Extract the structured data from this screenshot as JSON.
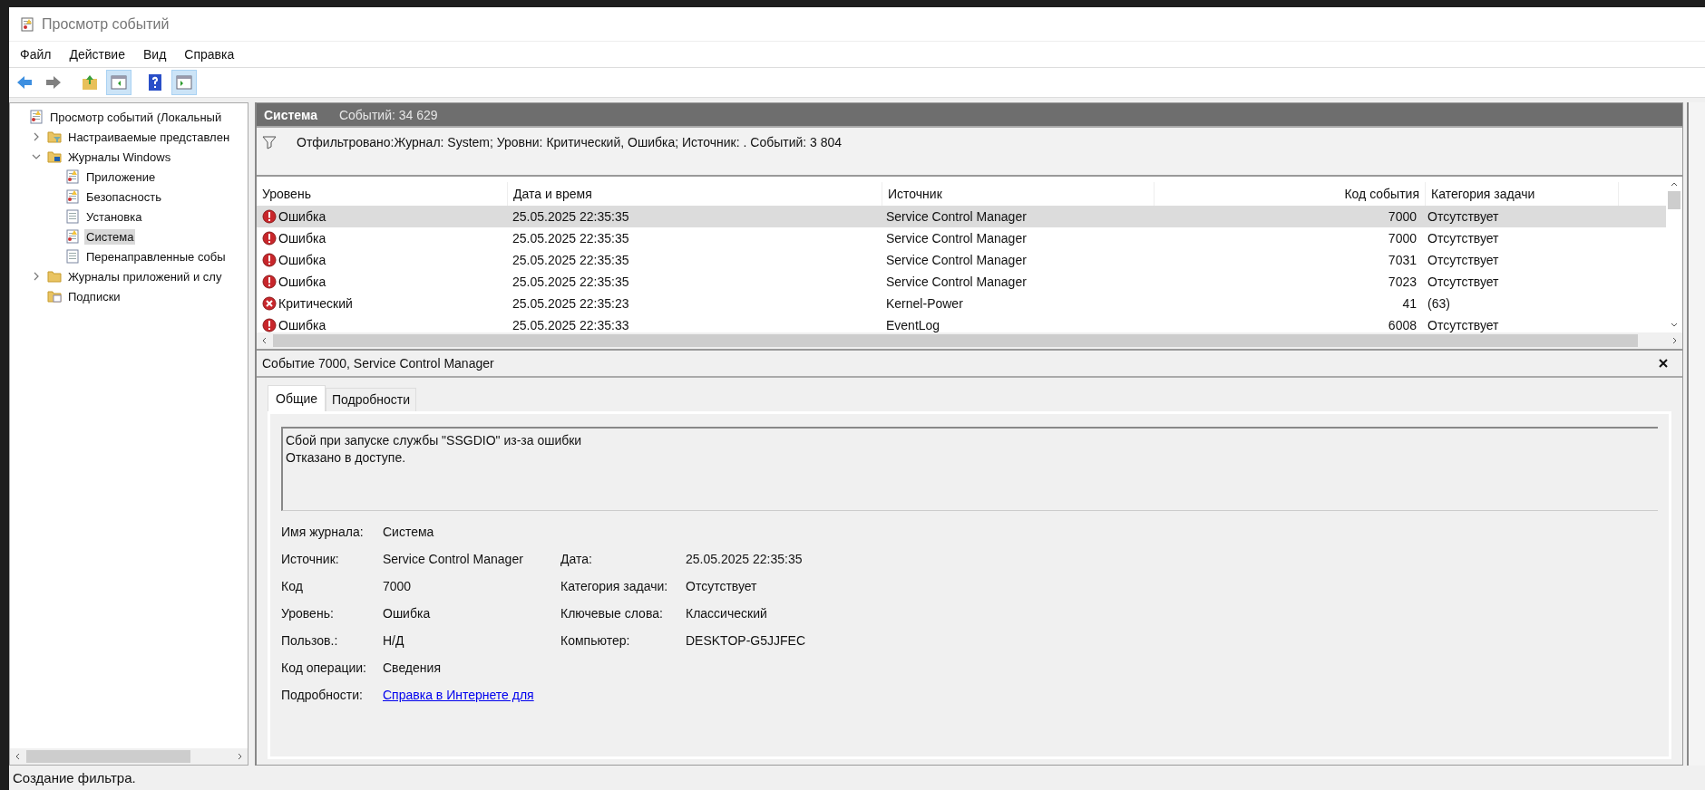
{
  "window": {
    "title": "Просмотр событий"
  },
  "menu": [
    "Файл",
    "Действие",
    "Вид",
    "Справка"
  ],
  "toolbar": [
    {
      "kind": "back",
      "pressed": false
    },
    {
      "kind": "forward",
      "pressed": false
    },
    {
      "kind": "up",
      "pressed": false
    },
    {
      "kind": "console-tree",
      "pressed": true
    },
    {
      "kind": "help",
      "pressed": false
    },
    {
      "kind": "action-pane",
      "pressed": true
    }
  ],
  "tree": [
    {
      "label": "Просмотр событий (Локальный",
      "kind": "log",
      "selected": false,
      "children": [
        {
          "label": "Настраиваемые представлен",
          "kind": "folder-filter",
          "expanded": false,
          "selected": false
        },
        {
          "label": "Журналы Windows",
          "kind": "folder-logs",
          "expanded": true,
          "selected": false,
          "children": [
            {
              "label": "Приложение",
              "kind": "log",
              "selected": false
            },
            {
              "label": "Безопасность",
              "kind": "log",
              "selected": false
            },
            {
              "label": "Установка",
              "kind": "log-plain",
              "selected": false
            },
            {
              "label": "Система",
              "kind": "log",
              "selected": true
            },
            {
              "label": "Перенаправленные собы",
              "kind": "log-plain",
              "selected": false
            }
          ]
        },
        {
          "label": "Журналы приложений и слу",
          "kind": "folder",
          "expanded": false,
          "selected": false
        },
        {
          "label": "Подписки",
          "kind": "folder-subs",
          "selected": false
        }
      ]
    }
  ],
  "header": {
    "title": "Система",
    "count": "Событий: 34 629"
  },
  "filter": "Отфильтровано:Журнал: System; Уровни: Критический, Ошибка; Источник: . Событий: 3 804",
  "table": {
    "columns": [
      "Уровень",
      "Дата и время",
      "Источник",
      "Код события",
      "Категория задачи"
    ],
    "rows": [
      {
        "kind": "error",
        "level": "Ошибка",
        "date": "25.05.2025 22:35:35",
        "source": "Service Control Manager",
        "code": "7000",
        "category": "Отсутствует",
        "selected": true
      },
      {
        "kind": "error",
        "level": "Ошибка",
        "date": "25.05.2025 22:35:35",
        "source": "Service Control Manager",
        "code": "7000",
        "category": "Отсутствует",
        "selected": false
      },
      {
        "kind": "error",
        "level": "Ошибка",
        "date": "25.05.2025 22:35:35",
        "source": "Service Control Manager",
        "code": "7031",
        "category": "Отсутствует",
        "selected": false
      },
      {
        "kind": "error",
        "level": "Ошибка",
        "date": "25.05.2025 22:35:35",
        "source": "Service Control Manager",
        "code": "7023",
        "category": "Отсутствует",
        "selected": false
      },
      {
        "kind": "critical",
        "level": "Критический",
        "date": "25.05.2025 22:35:23",
        "source": "Kernel-Power",
        "code": "41",
        "category": "(63)",
        "selected": false
      },
      {
        "kind": "error",
        "level": "Ошибка",
        "date": "25.05.2025 22:35:33",
        "source": "EventLog",
        "code": "6008",
        "category": "Отсутствует",
        "selected": false
      }
    ]
  },
  "detail": {
    "title": "Событие 7000, Service Control Manager",
    "tabs": [
      {
        "label": "Общие",
        "selected": true
      },
      {
        "label": "Подробности",
        "selected": false
      }
    ],
    "message": [
      "Сбой при запуске службы \"SSGDIO\" из-за ошибки",
      "Отказано в доступе."
    ],
    "fields": [
      {
        "left": {
          "label": "Имя журнала:",
          "value": "Система"
        }
      },
      {
        "left": {
          "label": "Источник:",
          "value": "Service Control Manager"
        },
        "right": {
          "label": "Дата:",
          "value": "25.05.2025 22:35:35"
        }
      },
      {
        "left": {
          "label": "Код",
          "value": "7000"
        },
        "right": {
          "label": "Категория задачи:",
          "value": "Отсутствует"
        }
      },
      {
        "left": {
          "label": "Уровень:",
          "value": "Ошибка"
        },
        "right": {
          "label": "Ключевые слова:",
          "value": "Классический"
        }
      },
      {
        "left": {
          "label": "Пользов.:",
          "value": "Н/Д"
        },
        "right": {
          "label": "Компьютер:",
          "value": "DESKTOP-G5JJFEC"
        }
      },
      {
        "left": {
          "label": "Код операции:",
          "value": "Сведения"
        }
      },
      {
        "left": {
          "label": "Подробности:",
          "value": "Справка в Интернете для",
          "kind": "link"
        }
      }
    ]
  },
  "status_bar": "Создание фильтра."
}
